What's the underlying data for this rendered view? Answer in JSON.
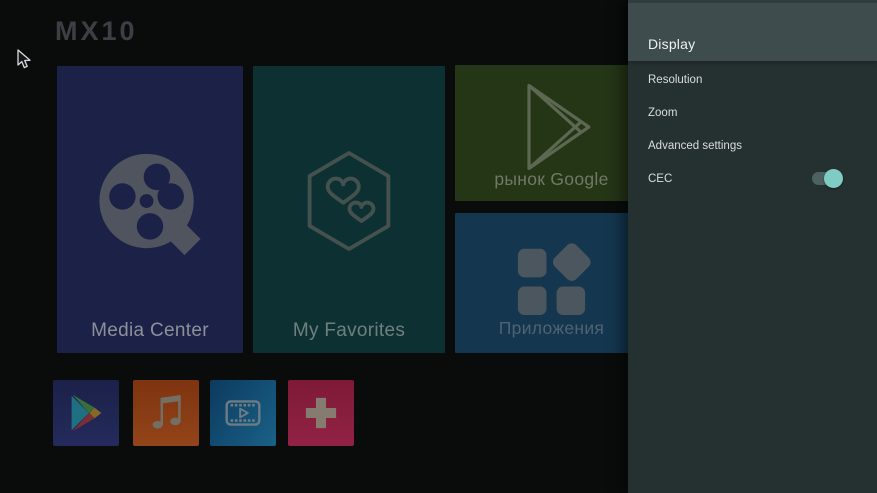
{
  "logo": {
    "text": "MX10"
  },
  "tiles": [
    {
      "label": "Media Center",
      "icon": "film-reel-icon",
      "bg": "#1c2247"
    },
    {
      "label": "My Favorites",
      "icon": "hearts-hexagon-icon",
      "bg": "#0d3133"
    },
    {
      "label": "рынок Google",
      "icon": "play-triangle-outline-icon",
      "bg": "#253617"
    },
    {
      "label": "Приложения",
      "icon": "app-grid-icon",
      "bg": "#14374f"
    }
  ],
  "dock": [
    {
      "name": "google-play",
      "icon": "google-play-icon"
    },
    {
      "name": "music",
      "icon": "music-note-icon"
    },
    {
      "name": "video",
      "icon": "film-strip-play-icon"
    },
    {
      "name": "add",
      "icon": "plus-icon"
    }
  ],
  "panel": {
    "title": "Display",
    "items": [
      {
        "label": "Resolution"
      },
      {
        "label": "Zoom"
      },
      {
        "label": "Advanced settings"
      },
      {
        "label": "CEC",
        "toggle_state": "on"
      }
    ],
    "header_bg": "#3e4c4d",
    "body_bg": "#253031",
    "toggle_on_color": "#80cbc4"
  }
}
